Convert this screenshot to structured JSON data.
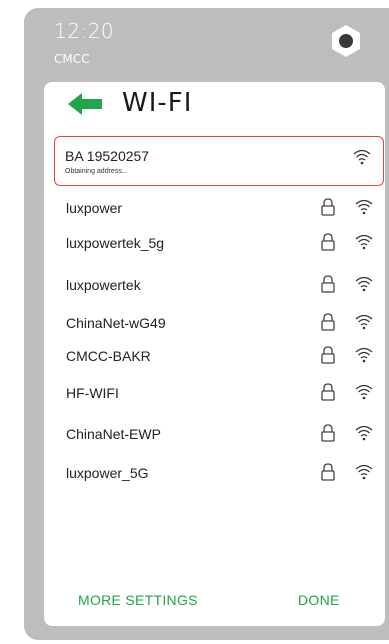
{
  "status": {
    "time": "12:20",
    "carrier": "CMCC"
  },
  "header": {
    "title": "WI-FI"
  },
  "connected": {
    "name": "BA 19520257",
    "status": "Obtaining address..."
  },
  "networks": [
    {
      "name": "luxpower",
      "secured": true
    },
    {
      "name": "luxpowertek_5g",
      "secured": true
    },
    {
      "name": "luxpowertek",
      "secured": true
    },
    {
      "name": "ChinaNet-wG49",
      "secured": true
    },
    {
      "name": "CMCC-BAKR",
      "secured": true
    },
    {
      "name": "HF-WIFI",
      "secured": true
    },
    {
      "name": "ChinaNet-EWP",
      "secured": true
    },
    {
      "name": "luxpower_5G",
      "secured": true
    }
  ],
  "footer": {
    "more_settings": "MORE SETTINGS",
    "done": "DONE"
  },
  "colors": {
    "accent": "#1fa64a",
    "active_border": "#e0443f",
    "frame": "#bdbdbd"
  },
  "icons": {
    "back": "left-arrow-icon",
    "lock": "lock-icon",
    "wifi": "wifi-icon",
    "settings": "hexagon-icon"
  }
}
